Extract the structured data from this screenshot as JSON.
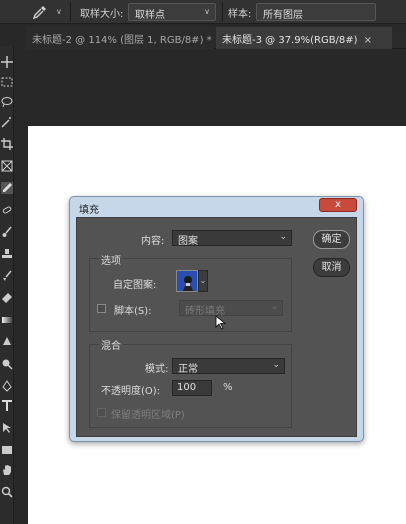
{
  "options_bar": {
    "sample_size_label": "取样大小:",
    "sample_size_value": "取样点",
    "sample_label": "样本:",
    "sample_value": "所有图层"
  },
  "tabs": [
    {
      "label": "未标题-2 @ 114% (图层 1, RGB/8#) *",
      "close": "×"
    },
    {
      "label": "未标题-3 @ 37.9%(RGB/8#)",
      "close": "×"
    }
  ],
  "dialog": {
    "title": "填充",
    "close": "x",
    "content_label": "内容:",
    "content_value": "图案",
    "ok_button": "确定",
    "cancel_button": "取消",
    "options_section": "选项",
    "custom_pattern_label": "自定图案:",
    "script_label": "脚本(S):",
    "script_value": "砖形填充",
    "blend_section": "混合",
    "mode_label": "模式:",
    "mode_value": "正常",
    "opacity_label": "不透明度(O):",
    "opacity_value": "100",
    "opacity_unit": "%",
    "preserve_label": "保留透明区域(P)"
  },
  "icons": [
    "eyedropper-icon",
    "move-icon",
    "marquee-icon",
    "lasso-icon",
    "magic-wand-icon",
    "crop-icon",
    "frame-icon",
    "eyedropper-tool-icon",
    "healing-icon",
    "brush-icon",
    "stamp-icon",
    "history-brush-icon",
    "eraser-icon",
    "gradient-icon",
    "blur-icon",
    "dodge-icon",
    "pen-icon",
    "type-icon",
    "path-select-icon",
    "rectangle-icon",
    "hand-icon",
    "zoom-icon"
  ]
}
